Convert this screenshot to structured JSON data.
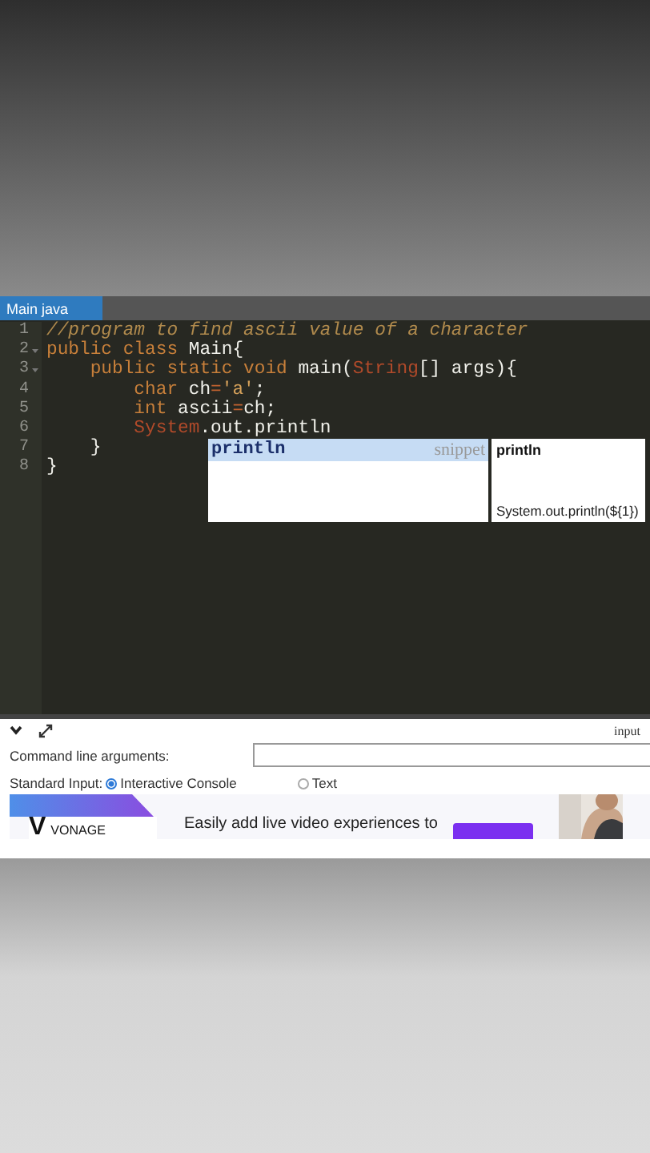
{
  "editor": {
    "tab": {
      "label": "Main java",
      "selected": true
    },
    "lines": [
      {
        "number": "1",
        "fold": false,
        "tokens": [
          {
            "kind": "comment",
            "text": "//program to find ascii value of a character"
          }
        ]
      },
      {
        "number": "2",
        "fold": true,
        "tokens": [
          {
            "kind": "keyword",
            "text": "public class "
          },
          {
            "kind": "plain",
            "text": "Main{"
          }
        ]
      },
      {
        "number": "3",
        "fold": true,
        "tokens": [
          {
            "kind": "keyword",
            "text": "    public static void "
          },
          {
            "kind": "plain",
            "text": "main("
          },
          {
            "kind": "type",
            "text": "String"
          },
          {
            "kind": "plain",
            "text": "[] args){"
          }
        ]
      },
      {
        "number": "4",
        "fold": false,
        "tokens": [
          {
            "kind": "keyword",
            "text": "        char "
          },
          {
            "kind": "plain",
            "text": "ch"
          },
          {
            "kind": "operator",
            "text": "="
          },
          {
            "kind": "string",
            "text": "'a'"
          },
          {
            "kind": "plain",
            "text": ";"
          }
        ]
      },
      {
        "number": "5",
        "fold": false,
        "tokens": [
          {
            "kind": "keyword",
            "text": "        int "
          },
          {
            "kind": "plain",
            "text": "ascii"
          },
          {
            "kind": "operator",
            "text": "="
          },
          {
            "kind": "plain",
            "text": "ch;"
          }
        ]
      },
      {
        "number": "6",
        "fold": false,
        "tokens": [
          {
            "kind": "type",
            "text": "        System"
          },
          {
            "kind": "plain",
            "text": ".out.println"
          }
        ]
      },
      {
        "number": "7",
        "fold": false,
        "tokens": [
          {
            "kind": "plain",
            "text": "    }"
          }
        ]
      },
      {
        "number": "8",
        "fold": false,
        "tokens": [
          {
            "kind": "plain",
            "text": "}"
          }
        ]
      }
    ],
    "autocomplete": {
      "items": [
        {
          "label": "println",
          "meta": "snippet",
          "selected": true
        }
      ],
      "doc_title": "println",
      "doc_body": "System.out.println(${1})"
    }
  },
  "panel": {
    "tab_label": "input",
    "args_label": "Command line arguments:",
    "stdin_label": "Standard Input:",
    "stdin_options": [
      {
        "label": "Interactive Console",
        "selected": true
      },
      {
        "label": "Text",
        "selected": false
      }
    ]
  },
  "ad": {
    "brand": "VONAGE",
    "logo_letter": "V",
    "headline": "Easily add live video experiences to"
  }
}
